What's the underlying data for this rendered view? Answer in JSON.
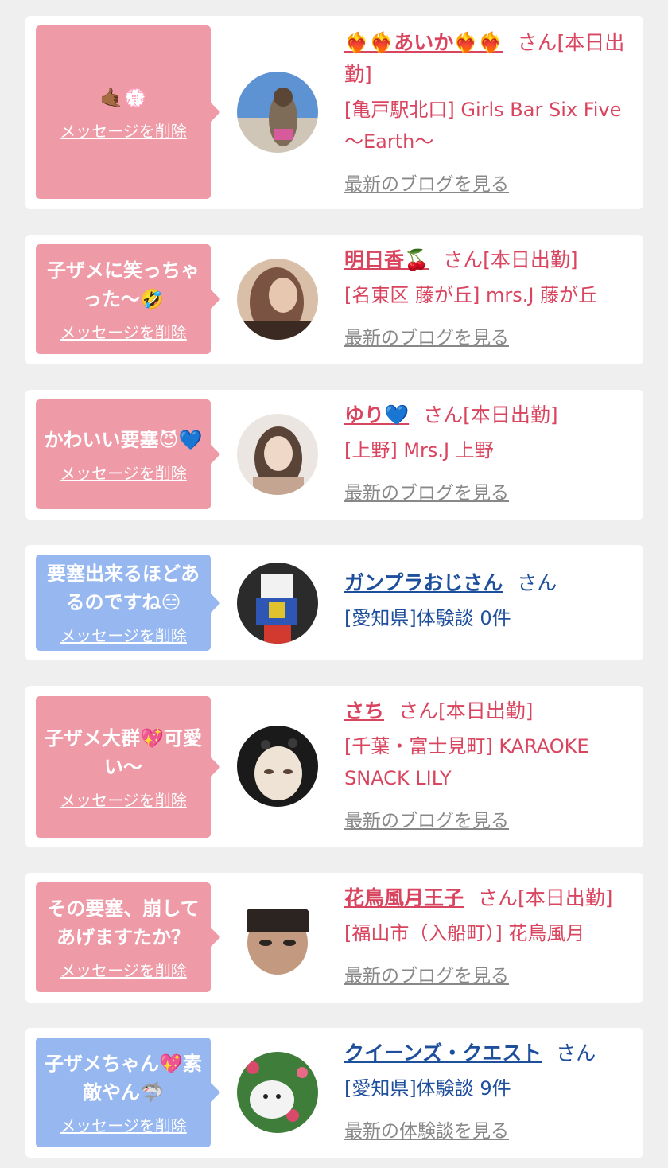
{
  "delete_label": "メッセージを削除",
  "cards": [
    {
      "message": "🤙🏾💮",
      "bubble_color": "pink",
      "name": "❤️‍🔥❤️‍🔥あいか❤️‍🔥❤️‍🔥",
      "suffix": "さん[本日出勤]",
      "shop": "[亀戸駅北口] Girls Bar Six Five 〜Earth〜",
      "link": "最新のブログを見る",
      "avatar_colors": [
        "#4f86c6",
        "#c8c0b6",
        "#7e6b58"
      ]
    },
    {
      "message": "子ザメに笑っちゃった〜🤣",
      "bubble_color": "pink",
      "name": "明日香🍒",
      "suffix": "さん[本日出勤]",
      "shop": "[名東区 藤が丘] mrs.J 藤が丘",
      "link": "最新のブログを見る",
      "avatar_colors": [
        "#d8b59a",
        "#7a5342",
        "#3a2a22"
      ]
    },
    {
      "message": "かわいい要塞😈💙",
      "bubble_color": "pink",
      "name": "ゆり💙",
      "suffix": "さん[本日出勤]",
      "shop": "[上野] Mrs.J 上野",
      "link": "最新のブログを見る",
      "avatar_colors": [
        "#e9e4df",
        "#c3a591",
        "#5a4438"
      ]
    },
    {
      "message": "要塞出来るほどあるのですね😑",
      "bubble_color": "blue",
      "name": "ガンプラおじさん",
      "suffix": "さん",
      "shop": "[愛知県]体験談 0件",
      "link": "",
      "avatar_colors": [
        "#2b2b2b",
        "#f2f2f2",
        "#2d56b5"
      ]
    },
    {
      "message": "子ザメ大群💖可愛い〜",
      "bubble_color": "pink",
      "name": "さち",
      "suffix": "さん[本日出勤]",
      "shop": "[千葉・富士見町] KARAOKE SNACK LILY",
      "link": "最新のブログを見る",
      "avatar_colors": [
        "#1a1a1a",
        "#efe3d6",
        "#b89a80"
      ]
    },
    {
      "message": "その要塞、崩してあげますたか？",
      "bubble_color": "pink",
      "name": "花鳥風月王子",
      "suffix": "さん[本日出勤]",
      "shop": "[福山市（入船町）] 花鳥風月",
      "link": "最新のブログを見る",
      "avatar_colors": [
        "#ffffff",
        "#c39a7f",
        "#2b2421"
      ]
    },
    {
      "message": "子ザメちゃん💖素敵やん🦈",
      "bubble_color": "blue",
      "name": "クイーンズ・クエスト",
      "suffix": "さん",
      "shop": "[愛知県]体験談 9件",
      "link": "最新の体験談を見る",
      "avatar_colors": [
        "#3f7d3a",
        "#f3f3f3",
        "#d9496a"
      ]
    }
  ]
}
